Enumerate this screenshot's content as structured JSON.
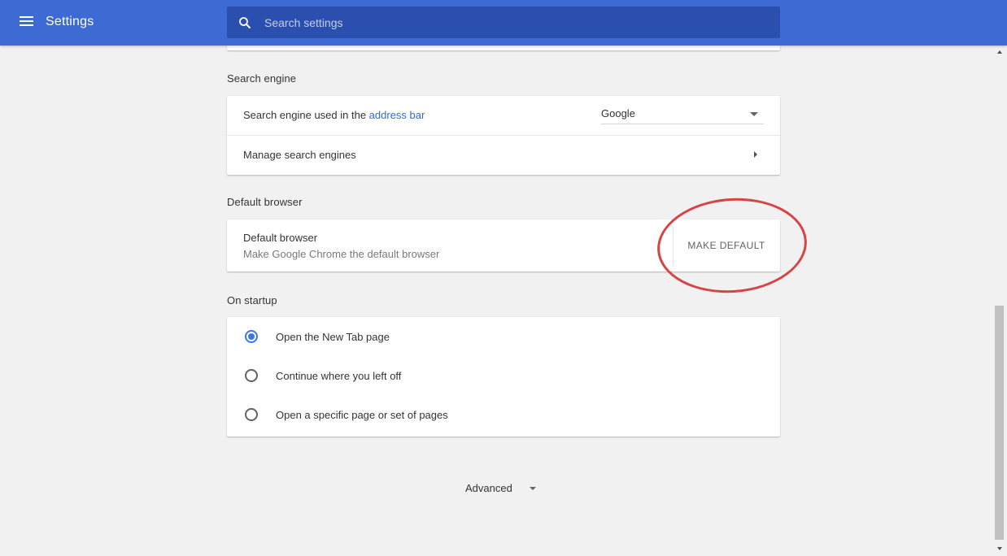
{
  "header": {
    "title": "Settings",
    "search_placeholder": "Search settings"
  },
  "search_engine": {
    "section_title": "Search engine",
    "engine_label_prefix": "Search engine used in the ",
    "engine_label_link": "address bar",
    "engine_value": "Google",
    "manage_label": "Manage search engines"
  },
  "default_browser": {
    "section_title": "Default browser",
    "row_title": "Default browser",
    "row_subtitle": "Make Google Chrome the default browser",
    "button_label": "MAKE DEFAULT"
  },
  "on_startup": {
    "section_title": "On startup",
    "options": [
      {
        "label": "Open the New Tab page",
        "selected": true
      },
      {
        "label": "Continue where you left off",
        "selected": false
      },
      {
        "label": "Open a specific page or set of pages",
        "selected": false
      }
    ]
  },
  "advanced": {
    "label": "Advanced"
  },
  "colors": {
    "header": "#3e6ad4",
    "accent": "#3367d6",
    "annotation": "#d64545"
  }
}
